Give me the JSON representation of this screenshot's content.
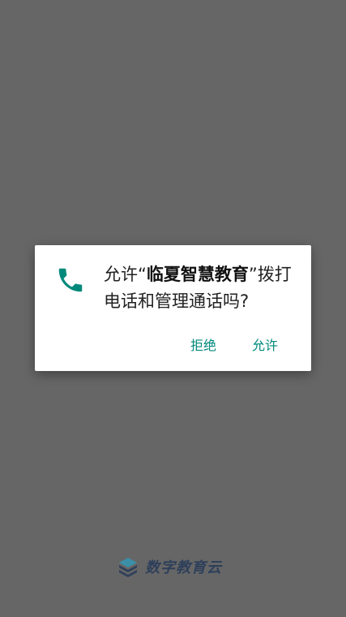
{
  "dialog": {
    "message_prefix": "允许“",
    "app_name": "临夏智慧教育",
    "message_suffix": "”拨打电话和管理通话吗?",
    "deny_label": "拒绝",
    "allow_label": "允许",
    "icon": "phone-icon",
    "accent_color": "#00897b"
  },
  "footer": {
    "brand_text": "数字教育云",
    "logo": "book-stack-logo"
  }
}
